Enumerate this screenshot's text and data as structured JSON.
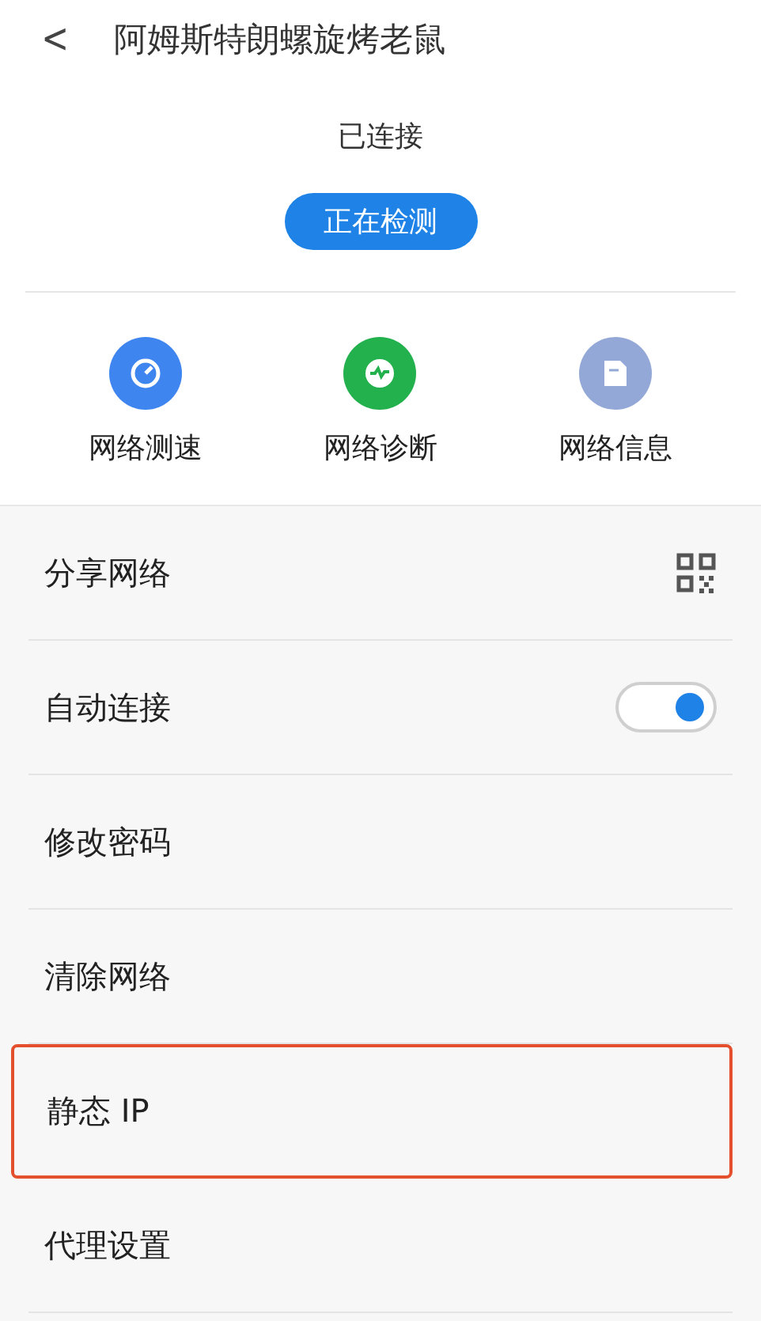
{
  "header": {
    "back": "<",
    "title": "阿姆斯特朗螺旋烤老鼠"
  },
  "status": {
    "text": "已连接",
    "button": "正在检测"
  },
  "tools": [
    {
      "label": "网络测速",
      "kind": "speed",
      "color": "#3f85f0"
    },
    {
      "label": "网络诊断",
      "kind": "pulse",
      "color": "#22b14c"
    },
    {
      "label": "网络信息",
      "kind": "doc",
      "color": "#93a8d6"
    }
  ],
  "settings": [
    {
      "label": "分享网络",
      "kind": "qr",
      "highlighted": false
    },
    {
      "label": "自动连接",
      "kind": "toggle",
      "on": true,
      "highlighted": false
    },
    {
      "label": "修改密码",
      "kind": "plain",
      "highlighted": false
    },
    {
      "label": "清除网络",
      "kind": "plain",
      "highlighted": false
    },
    {
      "label": "静态 IP",
      "kind": "plain",
      "highlighted": true
    },
    {
      "label": "代理设置",
      "kind": "plain",
      "highlighted": false
    }
  ]
}
